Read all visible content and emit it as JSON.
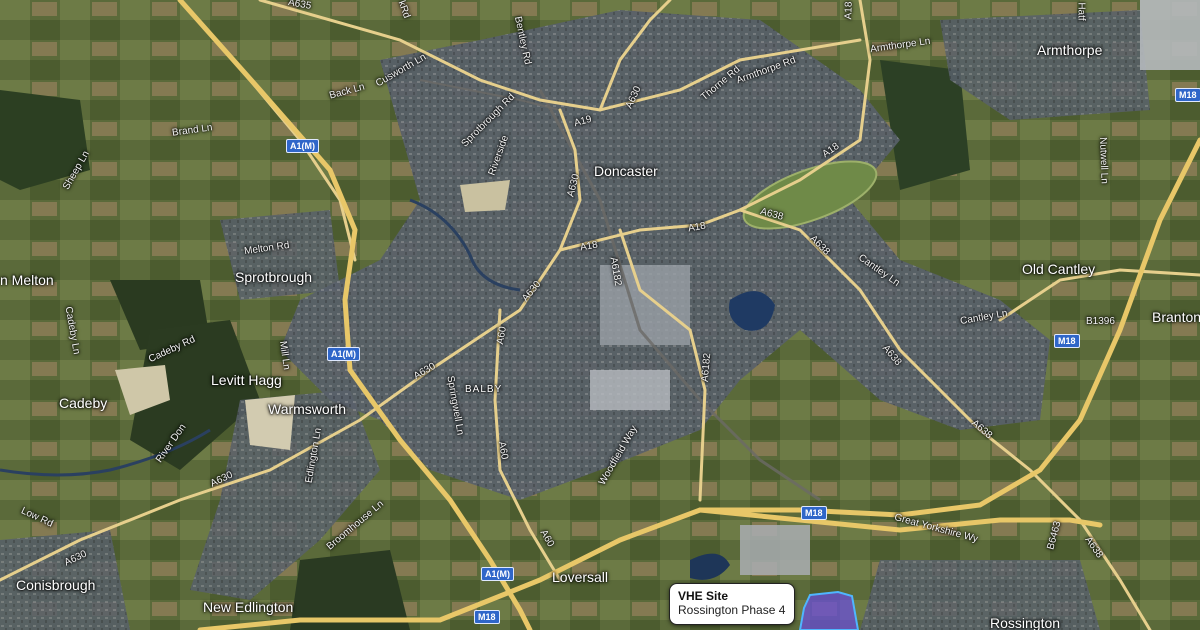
{
  "places": {
    "doncaster": "Doncaster",
    "armthorpe": "Armthorpe",
    "melton": "n Melton",
    "sprotbrough": "Sprotbrough",
    "old_cantley": "Old Cantley",
    "branton": "Branton",
    "levitt_hagg": "Levitt Hagg",
    "cadeby": "Cadeby",
    "warmsworth": "Warmsworth",
    "balby": "BALBY",
    "conisbrough": "Conisbrough",
    "loversall": "Loversall",
    "new_edlington": "New Edlington",
    "rossington": "Rossington"
  },
  "roads": {
    "a635": "A635",
    "bentley_rd": "Bentley Rd",
    "cusworth_ln": "Cusworth Ln",
    "back_ln": "Back Ln",
    "brand_ln": "Brand Ln",
    "sheep_ln": "Sheep Ln",
    "melton_rd": "Melton Rd",
    "cadeby_ln": "Cadeby Ln",
    "cadeby_rd": "Cadeby Rd",
    "mill_ln": "Mill Ln",
    "river_don": "River Don",
    "low_rd": "Low Rd",
    "a630_sw": "A630",
    "a630_w": "A630",
    "a630_mid": "A630",
    "a630_town": "A630",
    "a630_ne": "A630",
    "a630_n": "A630",
    "sprotbrough_rd": "Sprotbrough Rd",
    "riverside": "Riverside",
    "a19": "A19",
    "thorne_rd": "Thorne Rd",
    "armthorpe_rd": "Armthorpe Rd",
    "armthorpe_ln": "Armthorpe Ln",
    "a18_n": "A18",
    "a18_town": "A18",
    "a18_mid": "A18",
    "a638_e": "A638",
    "a638_ne": "A638",
    "a638_s": "A638",
    "a638_se": "A638",
    "a638_far": "A638",
    "a6182_n": "A6182",
    "a6182_s": "A6182",
    "a60_n": "A60",
    "a60_mid": "A60",
    "a60_s": "A60",
    "springwell_ln": "Springwell Ln",
    "woodfield_way": "Woodfield Way",
    "edlington_ln": "Edlington Ln",
    "broomhouse_ln": "Broomhouse Ln",
    "cantley_ln_n": "Cantley Ln",
    "cantley_ln_s": "Cantley Ln",
    "great_yorkshire_way": "Great Yorkshire Wy",
    "b6463": "B6463",
    "b1396": "B1396",
    "nutwell_ln": "Nutwell Ln",
    "hatfield": "Hatf",
    "a18_top": "A18",
    "kirk": "kRd"
  },
  "shields": {
    "a1m_n": "A1(M)",
    "a1m_mid": "A1(M)",
    "a1m_s": "A1(M)",
    "m18_mid": "M18",
    "m18_e": "M18",
    "m18_ne": "M18",
    "m18_sw": "M18"
  },
  "site": {
    "title": "VHE Site",
    "subtitle": "Rossington Phase 4",
    "highlight_color": "#6a4fd8",
    "outline_color": "#4fb6ff"
  },
  "colors": {
    "motorway": "#e8c768",
    "a_road": "#e6cf8c",
    "water": "#1f3a63"
  }
}
